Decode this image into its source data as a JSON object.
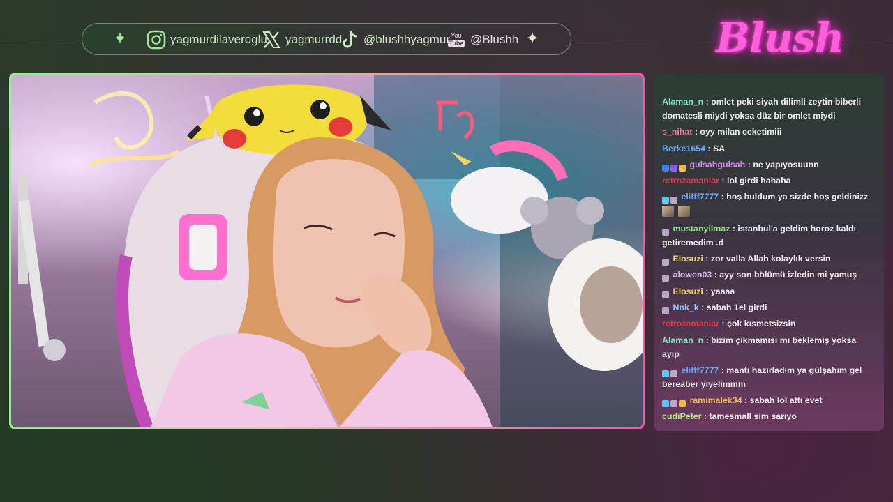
{
  "socials": [
    {
      "icon": "instagram-icon",
      "handle": "yagmurdilaveroglu"
    },
    {
      "icon": "x-twitter-icon",
      "handle": "yagmurrdd"
    },
    {
      "icon": "tiktok-icon",
      "handle": "@blushhyagmur"
    },
    {
      "icon": "youtube-icon",
      "handle": "@Blushh"
    }
  ],
  "youtube_badge": {
    "top": "You",
    "bottom": "Tube"
  },
  "brand": {
    "logo_text": "Blush"
  },
  "colors": {
    "accent_pink": "#ff5fd8",
    "accent_green": "#8ff08a"
  },
  "chat": {
    "messages": [
      {
        "user": "Alaman_n",
        "text": "omlet peki siyah dilimli zeytin biberli domatesli miydi yoksa düz bir omlet miydi",
        "color": "#7fe7c4",
        "badges": []
      },
      {
        "user": "s_nihat",
        "text": "oyy milan ceketimiii",
        "color": "#f07aa0",
        "badges": []
      },
      {
        "user": "Berke1654",
        "text": "SA",
        "color": "#6aa8ff",
        "badges": []
      },
      {
        "user": "gulsahgulsah",
        "text": "ne yapıyosuunn",
        "color": "#d58be8",
        "badges": [
          "prime",
          "hype",
          "gift"
        ]
      },
      {
        "user": "retrozamanlar",
        "text": "lol girdi hahaha",
        "color": "#e2354a",
        "badges": []
      },
      {
        "user": "elifff7777",
        "text": "hoş buldum ya sizde hoş geldinizz",
        "color": "#6aa8ff",
        "badges": [
          "drop",
          "sub"
        ],
        "emotes": 2
      },
      {
        "user": "mustanyilmaz",
        "text": "istanbul'a geldim horoz kaldı getiremedim .d",
        "color": "#8fe08a",
        "badges": [
          "sub"
        ]
      },
      {
        "user": "Elosuzi",
        "text": "zor valla Allah kolaylık versin",
        "color": "#f2d36b",
        "badges": [
          "sub"
        ]
      },
      {
        "user": "alowen03",
        "text": "ayy son bölümü izledin mi yamuş",
        "color": "#c9b8f0",
        "badges": [
          "sub"
        ]
      },
      {
        "user": "Elosuzi",
        "text": "yaaaa",
        "color": "#f2d36b",
        "badges": [
          "sub"
        ]
      },
      {
        "user": "Nnk_k",
        "text": "sabah 1el girdi",
        "color": "#8ecbff",
        "badges": [
          "sub"
        ]
      },
      {
        "user": "retrozamanlar",
        "text": "çok kısmetsizsin",
        "color": "#e2354a",
        "badges": []
      },
      {
        "user": "Alaman_n",
        "text": "bizim çıkmamısı mı beklemiş yoksa ayıp",
        "color": "#7fe7c4",
        "badges": []
      },
      {
        "user": "elifff7777",
        "text": "mantı hazırladım ya gülşahım gel bereaber yiyelimmm",
        "color": "#6aa8ff",
        "badges": [
          "drop",
          "sub"
        ]
      },
      {
        "user": "ramimalek34",
        "text": "sabah lol attı evet",
        "color": "#f2b84b",
        "badges": [
          "drop",
          "sub",
          "gold"
        ]
      },
      {
        "user": "cudiPeter",
        "text": "tamesmall sim sarıyo",
        "color": "#a9f07a",
        "badges": []
      }
    ]
  }
}
